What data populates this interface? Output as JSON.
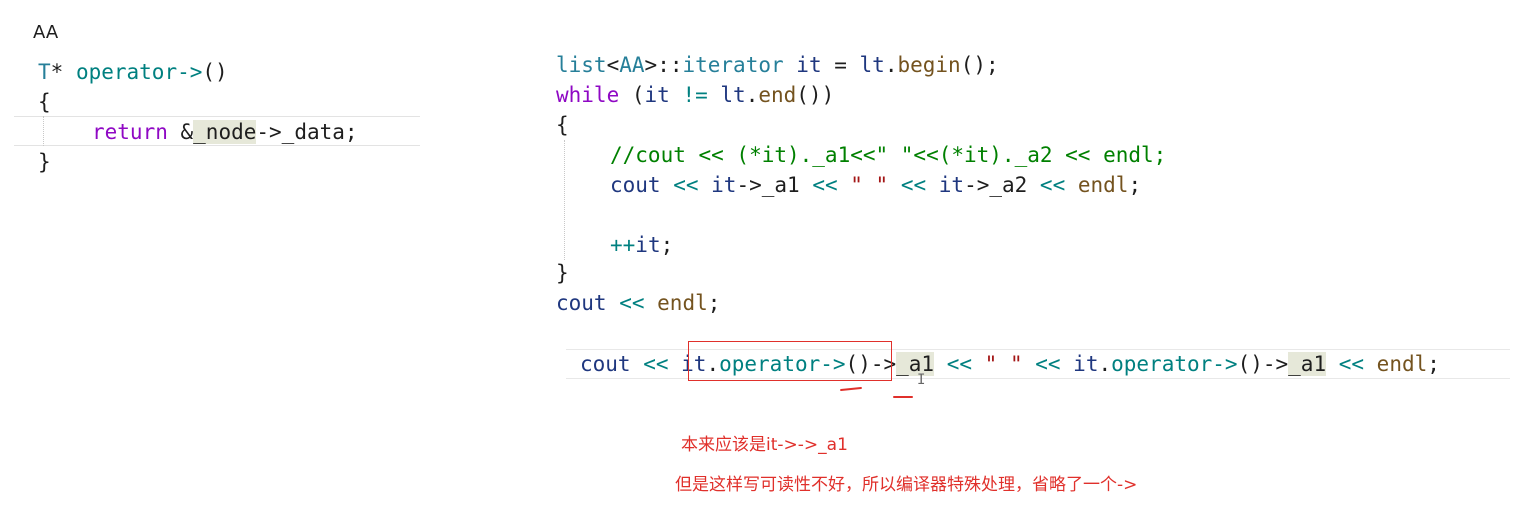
{
  "left_panel": {
    "label": "AA",
    "line1": {
      "type": "T",
      "star": "* ",
      "name": "operator->",
      "parens": "()"
    },
    "line2": "{",
    "line3": {
      "keyword": "return",
      "amp": " &",
      "member1": "_node",
      "arrow": "->",
      "member2": "_data",
      "semi": ";"
    },
    "line4": "}"
  },
  "right_panel": {
    "l1": {
      "list": "list",
      "lt": "<",
      "aa": "AA",
      "gt": ">",
      "scope": "::",
      "iterator": "iterator",
      "it": "it",
      "eq": " = ",
      "obj": "lt",
      "dot": ".",
      "begin": "begin",
      "tail": "();"
    },
    "l2": {
      "while": "while",
      "open": " (",
      "it": "it",
      "ne": " != ",
      "obj": "lt",
      "dot": ".",
      "end": "end",
      "tail": "())"
    },
    "l3": "{",
    "l4": "//cout << (*it)._a1<<\" \"<<(*it)._a2 << endl;",
    "l5": {
      "cout": "cout",
      "s1": " << ",
      "it1": "it",
      "a1": "->_a1",
      "s2": " << ",
      "str": "\" \"",
      "s3": " << ",
      "it2": "it",
      "a2": "->_a2",
      "s4": " << ",
      "endl": "endl",
      "semi": ";"
    },
    "l6": "++it;",
    "l6_op": "++",
    "l6_it": "it",
    "l7": "}",
    "l8": {
      "cout": "cout",
      "s1": " << ",
      "endl": "endl",
      "semi": ";"
    }
  },
  "bottom_line": {
    "cout": "cout",
    "s1": " << ",
    "it1": "it",
    "dot1": ".",
    "op1": "operator->",
    "p1": "()",
    "ar1": "->",
    "a1": "_a1",
    "s2": " << ",
    "str": "\" \"",
    "s3": " << ",
    "it2": "it",
    "dot2": ".",
    "op2": "operator->",
    "p2": "()",
    "ar2": "->",
    "a2": "_a1",
    "s4": " << ",
    "endl": "endl",
    "semi": ";"
  },
  "notes": {
    "note1": "本来应该是it->->_a1",
    "note2": "但是这样写可读性不好，所以编译器特殊处理，省略了一个->"
  },
  "colors": {
    "annotation_red": "#e0302b",
    "keyword": "#8f08c4",
    "type": "#267f99",
    "comment": "#008000"
  }
}
